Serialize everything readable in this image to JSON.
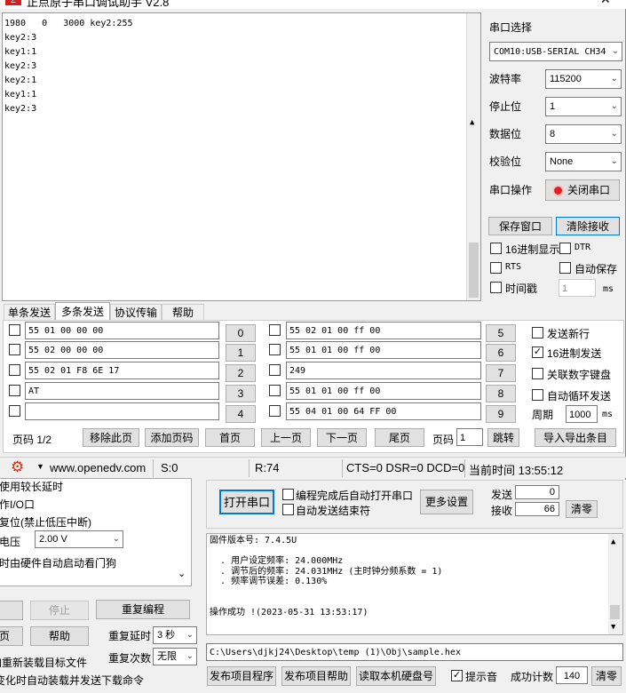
{
  "serial": {
    "title": "正点原子串口调试助手 V2.8",
    "receive_lines": [
      "1980   0   3000 key2:255",
      "key2:3",
      "key1:1",
      "key2:3",
      "key2:1",
      "key1:1",
      "key2:3"
    ],
    "port_label": "串口选择",
    "port_value": "COM10:USB-SERIAL CH34",
    "baud_label": "波特率",
    "baud_value": "115200",
    "stopbit_label": "停止位",
    "stopbit_value": "1",
    "databit_label": "数据位",
    "databit_value": "8",
    "parity_label": "校验位",
    "parity_value": "None",
    "op_label": "串口操作",
    "close_port": "关闭串口",
    "save_window": "保存窗口",
    "clear_receive": "清除接收",
    "hex_display": "16进制显示",
    "dtr": "DTR",
    "rts": "RTS",
    "auto_save": "自动保存",
    "timestamp": "时间戳",
    "timestamp_value": "1",
    "ms": "ms",
    "tabs": [
      "单条发送",
      "多条发送",
      "协议传输",
      "帮助"
    ],
    "send_left": [
      {
        "text": "55 01 00 00 00",
        "num": "0"
      },
      {
        "text": "55 02 00 00 00",
        "num": "1"
      },
      {
        "text": "55 02 01 F8 6E 17",
        "num": "2"
      },
      {
        "text": "AT",
        "num": "3"
      },
      {
        "text": "",
        "num": "4"
      }
    ],
    "send_right": [
      {
        "text": "55 02 01 00 ff 00",
        "num": "5"
      },
      {
        "text": "55 01 01 00 ff 00",
        "num": "6"
      },
      {
        "text": "249",
        "num": "7"
      },
      {
        "text": "55 01 01 00 ff 00",
        "num": "8"
      },
      {
        "text": "55 04 01 00 64 FF 00",
        "num": "9"
      }
    ],
    "send_newline": "发送新行",
    "hex_send": "16进制发送",
    "numpad": "关联数字键盘",
    "auto_loop": "自动循环发送",
    "period_label": "周期",
    "period_value": "1000",
    "page_info": "页码 1/2",
    "remove_page": "移除此页",
    "add_page": "添加页码",
    "first_page": "首页",
    "prev_page": "上一页",
    "next_page": "下一页",
    "last_page": "尾页",
    "page_label": "页码",
    "page_value": "1",
    "jump": "跳转",
    "import_export": "导入导出条目",
    "website": "www.openedv.com",
    "s_count": "S:0",
    "r_count": "R:74",
    "signals": "CTS=0 DSR=0 DCD=0",
    "time": "当前时间 13:55:12"
  },
  "isp": {
    "opt1": "使用较长延时",
    "opt2": "作I/O口",
    "opt3": "复位(禁止低压中断)",
    "voltage_label": "电压",
    "voltage_value": "2.00 V",
    "opt4": "时由硬件自动启动看门狗",
    "open_port": "打开串口",
    "auto_open": "编程完成后自动打开串口",
    "auto_send_end": "自动发送结束符",
    "more_settings": "更多设置",
    "send_label": "发送",
    "send_value": "0",
    "recv_label": "接收",
    "recv_value": "66",
    "clear": "清零",
    "log": [
      "固件版本号: 7.4.5U",
      "",
      "  . 用户设定频率: 24.000MHz",
      "  . 调节后的频率: 24.031MHz (主时钟分频系数 = 1)",
      "  . 频率调节误差: 0.130%",
      "",
      "",
      "操作成功 !(2023-05-31 13:53:17)"
    ],
    "stop": "停止",
    "reprogram": "重复编程",
    "help": "帮助",
    "page_btn": "页",
    "repeat_delay_label": "重复延时",
    "repeat_delay_value": "3 秒",
    "repeat_count_label": "重复次数",
    "repeat_count_value": "无限",
    "reload_text": "加重新装载目标文件",
    "auto_text": "变化时自动装载并发送下载命令",
    "file_path": "C:\\Users\\djkj24\\Desktop\\temp (1)\\Obj\\sample.hex",
    "publish_prog": "发布项目程序",
    "publish_help": "发布项目帮助",
    "read_disk": "读取本机硬盘号",
    "beep": "提示音",
    "success_label": "成功计数",
    "success_value": "140",
    "clear2": "清零"
  }
}
